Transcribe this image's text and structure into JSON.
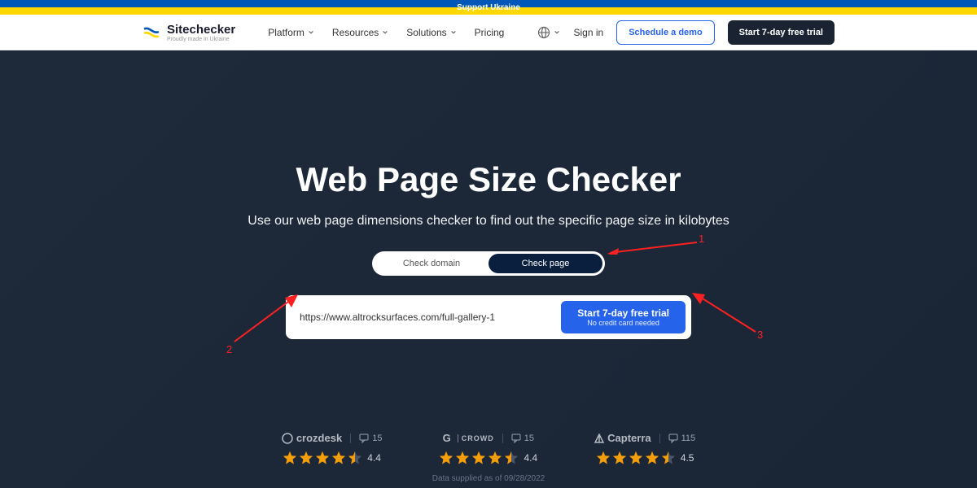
{
  "banner": {
    "text": "Support Ukraine"
  },
  "logo": {
    "name": "Sitechecker",
    "tagline": "Proudly made in Ukraine"
  },
  "nav": {
    "items": [
      {
        "label": "Platform",
        "dropdown": true
      },
      {
        "label": "Resources",
        "dropdown": true
      },
      {
        "label": "Solutions",
        "dropdown": true
      },
      {
        "label": "Pricing",
        "dropdown": false
      }
    ]
  },
  "header": {
    "signin": "Sign in",
    "demo": "Schedule a demo",
    "trial": "Start 7-day free trial"
  },
  "hero": {
    "title": "Web Page Size Checker",
    "subtitle": "Use our web page dimensions checker to find out the specific page size in kilobytes"
  },
  "toggle": {
    "domain": "Check domain",
    "page": "Check page",
    "active": "page"
  },
  "input": {
    "value": "https://www.altrocksurfaces.com/full-gallery-1"
  },
  "cta": {
    "main": "Start 7-day free trial",
    "sub": "No credit card needed"
  },
  "reviews": [
    {
      "brand": "crozdesk",
      "count": "15",
      "rating": "4.4",
      "stars": 4.5
    },
    {
      "brand": "CROWD",
      "count": "15",
      "rating": "4.4",
      "stars": 4.5
    },
    {
      "brand": "Capterra",
      "count": "115",
      "rating": "4.5",
      "stars": 4.5
    }
  ],
  "data_note": "Data supplied as of 09/28/2022",
  "annotations": [
    {
      "label": "1"
    },
    {
      "label": "2"
    },
    {
      "label": "3"
    }
  ]
}
